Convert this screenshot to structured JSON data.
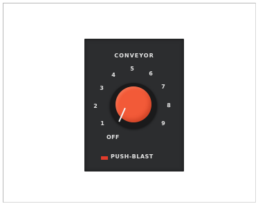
{
  "panel": {
    "title": "CONVEYOR",
    "dial_numbers": [
      "1",
      "2",
      "3",
      "4",
      "5",
      "6",
      "7",
      "8",
      "9"
    ],
    "off_label": "OFF",
    "push_label": "PUSH-BLAST",
    "colors": {
      "panel": "#2c2d2f",
      "knob": "#f25a38",
      "marker": "#e23b2b",
      "text": "#e4e4e4"
    }
  }
}
